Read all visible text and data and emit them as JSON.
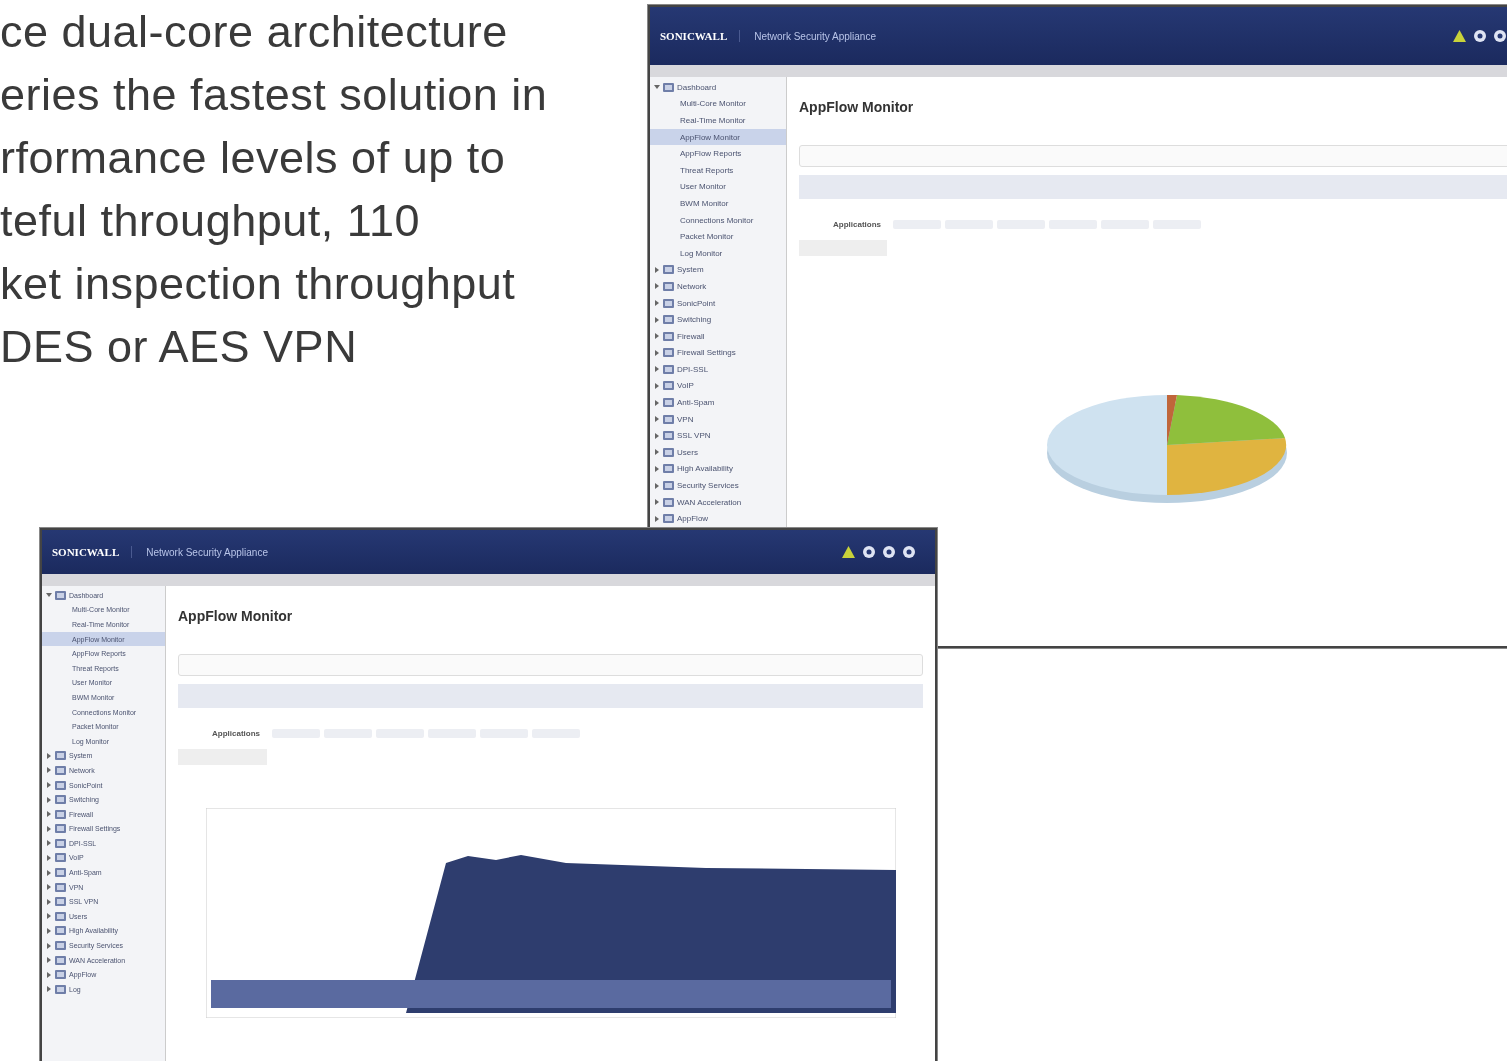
{
  "brochure_text": [
    "ce dual-core architecture",
    "eries the fastest solution in",
    "rformance levels of up to",
    "teful throughput, 110",
    "ket inspection throughput",
    "DES or AES VPN"
  ],
  "windows": [
    {
      "logo": "SONICWALL",
      "title": "Network Security Appliance",
      "page_title": "AppFlow Monitor",
      "first_tab": "Applications",
      "chart": {
        "kind": "pie"
      },
      "sidebar": {
        "items": [
          {
            "label": "Dashboard",
            "expanded": true,
            "children": [
              {
                "label": "Multi-Core Monitor",
                "selected": false
              },
              {
                "label": "Real-Time Monitor",
                "selected": false
              },
              {
                "label": "AppFlow Monitor",
                "selected": true
              },
              {
                "label": "AppFlow Reports",
                "selected": false
              },
              {
                "label": "Threat Reports",
                "selected": false
              },
              {
                "label": "User Monitor",
                "selected": false
              },
              {
                "label": "BWM Monitor",
                "selected": false
              },
              {
                "label": "Connections Monitor",
                "selected": false
              },
              {
                "label": "Packet Monitor",
                "selected": false
              },
              {
                "label": "Log Monitor",
                "selected": false
              }
            ]
          },
          {
            "label": "System",
            "expanded": false
          },
          {
            "label": "Network",
            "expanded": false
          },
          {
            "label": "SonicPoint",
            "expanded": false
          },
          {
            "label": "Switching",
            "expanded": false
          },
          {
            "label": "Firewall",
            "expanded": false
          },
          {
            "label": "Firewall Settings",
            "expanded": false
          },
          {
            "label": "DPI-SSL",
            "expanded": false
          },
          {
            "label": "VoIP",
            "expanded": false
          },
          {
            "label": "Anti-Spam",
            "expanded": false
          },
          {
            "label": "VPN",
            "expanded": false
          },
          {
            "label": "SSL VPN",
            "expanded": false
          },
          {
            "label": "Users",
            "expanded": false
          },
          {
            "label": "High Availability",
            "expanded": false
          },
          {
            "label": "Security Services",
            "expanded": false
          },
          {
            "label": "WAN Acceleration",
            "expanded": false
          },
          {
            "label": "AppFlow",
            "expanded": false
          }
        ]
      }
    },
    {
      "logo": "SONICWALL",
      "title": "Network Security Appliance",
      "page_title": "AppFlow Monitor",
      "first_tab": "Applications",
      "chart": {
        "kind": "area"
      },
      "sidebar": {
        "items": [
          {
            "label": "Dashboard",
            "expanded": true,
            "children": [
              {
                "label": "Multi-Core Monitor",
                "selected": false
              },
              {
                "label": "Real-Time Monitor",
                "selected": false
              },
              {
                "label": "AppFlow Monitor",
                "selected": true
              },
              {
                "label": "AppFlow Reports",
                "selected": false
              },
              {
                "label": "Threat Reports",
                "selected": false
              },
              {
                "label": "User Monitor",
                "selected": false
              },
              {
                "label": "BWM Monitor",
                "selected": false
              },
              {
                "label": "Connections Monitor",
                "selected": false
              },
              {
                "label": "Packet Monitor",
                "selected": false
              },
              {
                "label": "Log Monitor",
                "selected": false
              }
            ]
          },
          {
            "label": "System",
            "expanded": false
          },
          {
            "label": "Network",
            "expanded": false
          },
          {
            "label": "SonicPoint",
            "expanded": false
          },
          {
            "label": "Switching",
            "expanded": false
          },
          {
            "label": "Firewall",
            "expanded": false
          },
          {
            "label": "Firewall Settings",
            "expanded": false
          },
          {
            "label": "DPI-SSL",
            "expanded": false
          },
          {
            "label": "VoIP",
            "expanded": false
          },
          {
            "label": "Anti-Spam",
            "expanded": false
          },
          {
            "label": "VPN",
            "expanded": false
          },
          {
            "label": "SSL VPN",
            "expanded": false
          },
          {
            "label": "Users",
            "expanded": false
          },
          {
            "label": "High Availability",
            "expanded": false
          },
          {
            "label": "Security Services",
            "expanded": false
          },
          {
            "label": "WAN Acceleration",
            "expanded": false
          },
          {
            "label": "AppFlow",
            "expanded": false
          },
          {
            "label": "Log",
            "expanded": false
          }
        ]
      }
    }
  ]
}
